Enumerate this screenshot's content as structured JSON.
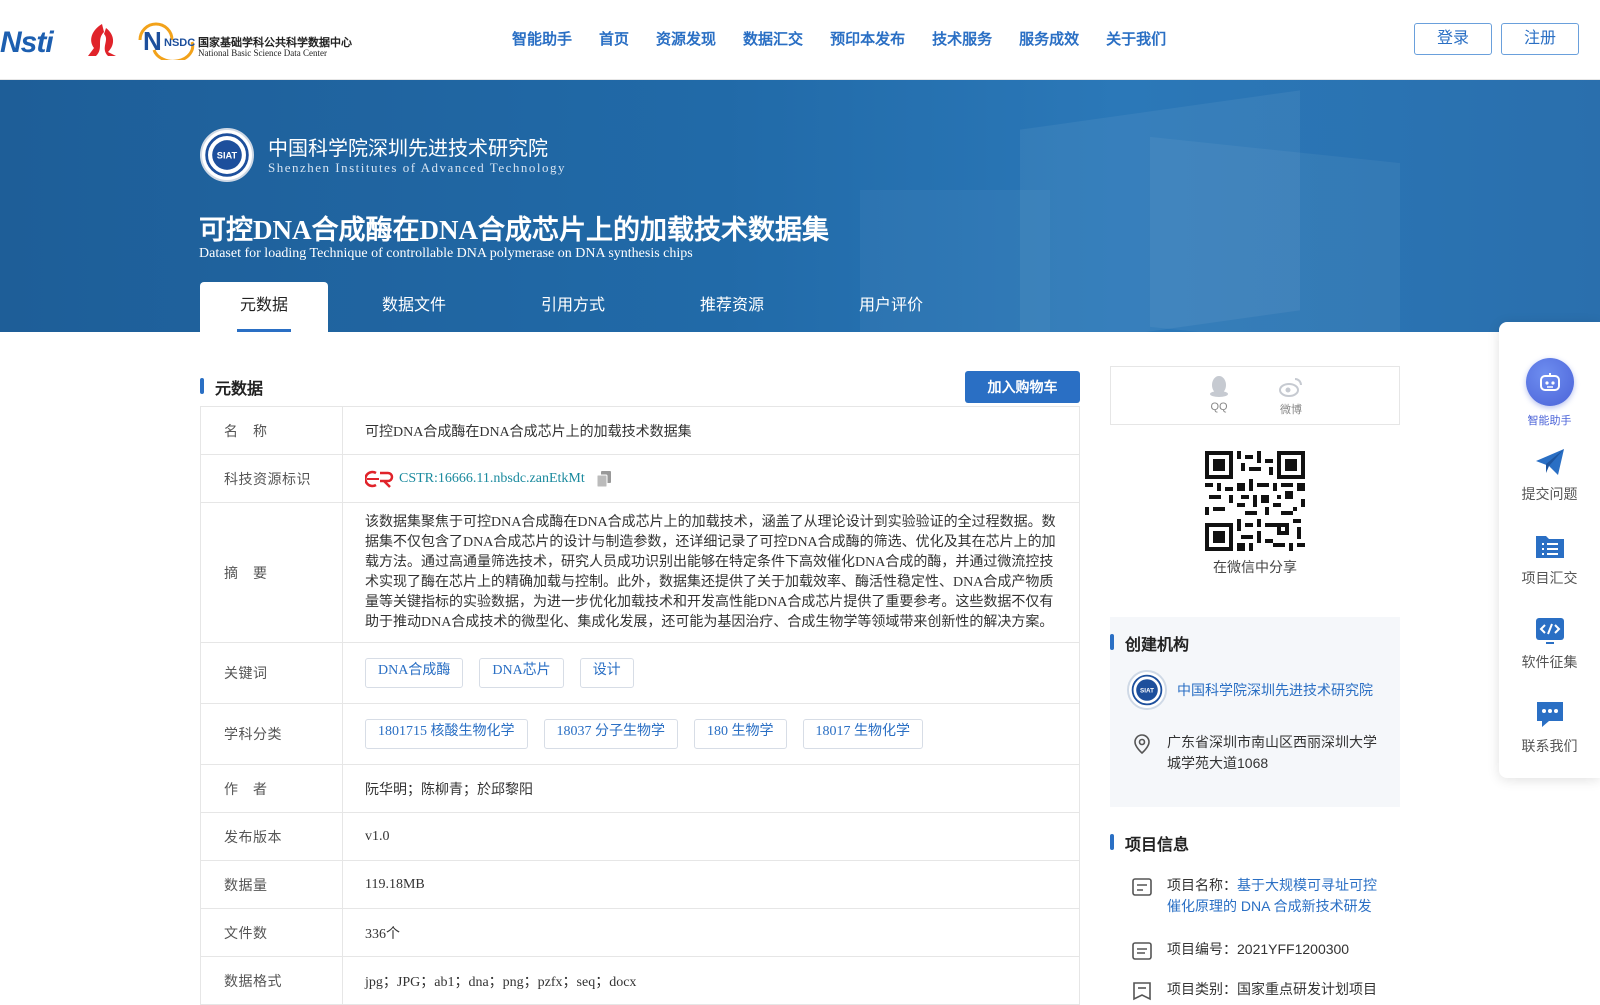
{
  "header": {
    "logos": [
      "nsti-logo",
      "red-logo",
      "nsdc-logo"
    ],
    "nsdc": {
      "badge": "NSDC",
      "cn": "国家基础学科公共科学数据中心",
      "en": "National Basic Science Data Center"
    },
    "nsti_text": "Nsti",
    "nav": [
      "智能助手",
      "首页",
      "资源发现",
      "数据汇交",
      "预印本发布",
      "技术服务",
      "服务成效",
      "关于我们"
    ],
    "login_label": "登录",
    "register_label": "注册"
  },
  "banner": {
    "institution_cn": "中国科学院深圳先进技术研究院",
    "institution_en": "Shenzhen Institutes of Advanced Technology",
    "institution_logo_text": "SIAT",
    "title": "可控DNA合成酶在DNA合成芯片上的加载技术数据集",
    "subtitle": "Dataset for loading Technique of controllable DNA polymerase on DNA synthesis chips",
    "tabs": [
      "元数据",
      "数据文件",
      "引用方式",
      "推荐资源",
      "用户评价"
    ],
    "active_tab": 0
  },
  "metadata": {
    "section_title": "元数据",
    "add_cart_label": "加入购物车",
    "rows": {
      "name": {
        "key": "名　称",
        "value": "可控DNA合成酶在DNA合成芯片上的加载技术数据集"
      },
      "cstr": {
        "key": "科技资源标识",
        "value": "CSTR:16666.11.nbsdc.zanEtkMt"
      },
      "abstract": {
        "key": "摘　要",
        "value": "该数据集聚焦于可控DNA合成酶在DNA合成芯片上的加载技术，涵盖了从理论设计到实验验证的全过程数据。数据集不仅包含了DNA合成芯片的设计与制造参数，还详细记录了可控DNA合成酶的筛选、优化及其在芯片上的加载方法。通过高通量筛选技术，研究人员成功识别出能够在特定条件下高效催化DNA合成的酶，并通过微流控技术实现了酶在芯片上的精确加载与控制。此外，数据集还提供了关于加载效率、酶活性稳定性、DNA合成产物质量等关键指标的实验数据，为进一步优化加载技术和开发高性能DNA合成芯片提供了重要参考。这些数据不仅有助于推动DNA合成技术的微型化、集成化发展，还可能为基因治疗、合成生物学等领域带来创新性的解决方案。"
      },
      "keywords": {
        "key": "关键词",
        "tags": [
          "DNA合成酶",
          "DNA芯片",
          "设计"
        ]
      },
      "subjects": {
        "key": "学科分类",
        "tags": [
          "1801715 核酸生物化学",
          "18037 分子生物学",
          "180 生物学",
          "18017 生物化学"
        ]
      },
      "authors": {
        "key": "作　者",
        "value": "阮华明；陈柳青；於邱黎阳"
      },
      "version": {
        "key": "发布版本",
        "value": "v1.0"
      },
      "size": {
        "key": "数据量",
        "value": "119.18MB"
      },
      "file_count": {
        "key": "文件数",
        "value": "336个"
      },
      "formats": {
        "key": "数据格式",
        "value": "jpg；JPG；ab1；dna；png；pzfx；seq；docx"
      }
    }
  },
  "share": {
    "qq_label": "QQ",
    "weibo_label": "微博",
    "wechat_caption": "在微信中分享"
  },
  "creator": {
    "section_title": "创建机构",
    "name": "中国科学院深圳先进技术研究院",
    "logo_text": "SIAT",
    "address": "广东省深圳市南山区西丽深圳大学城学苑大道1068"
  },
  "project": {
    "section_title": "项目信息",
    "name_label": "项目名称：",
    "name_value": "基于大规模可寻址可控催化原理的 DNA 合成新技术研发",
    "number": "项目编号：2021YFF1200300",
    "category": "项目类别：国家重点研发计划项目"
  },
  "floatbar": {
    "items": [
      "智能助手",
      "提交问题",
      "项目汇交",
      "软件征集",
      "联系我们"
    ]
  },
  "colors": {
    "brand": "#2a6fc4",
    "banner": "#216aa8",
    "accent_teal": "#1a8a9e"
  }
}
